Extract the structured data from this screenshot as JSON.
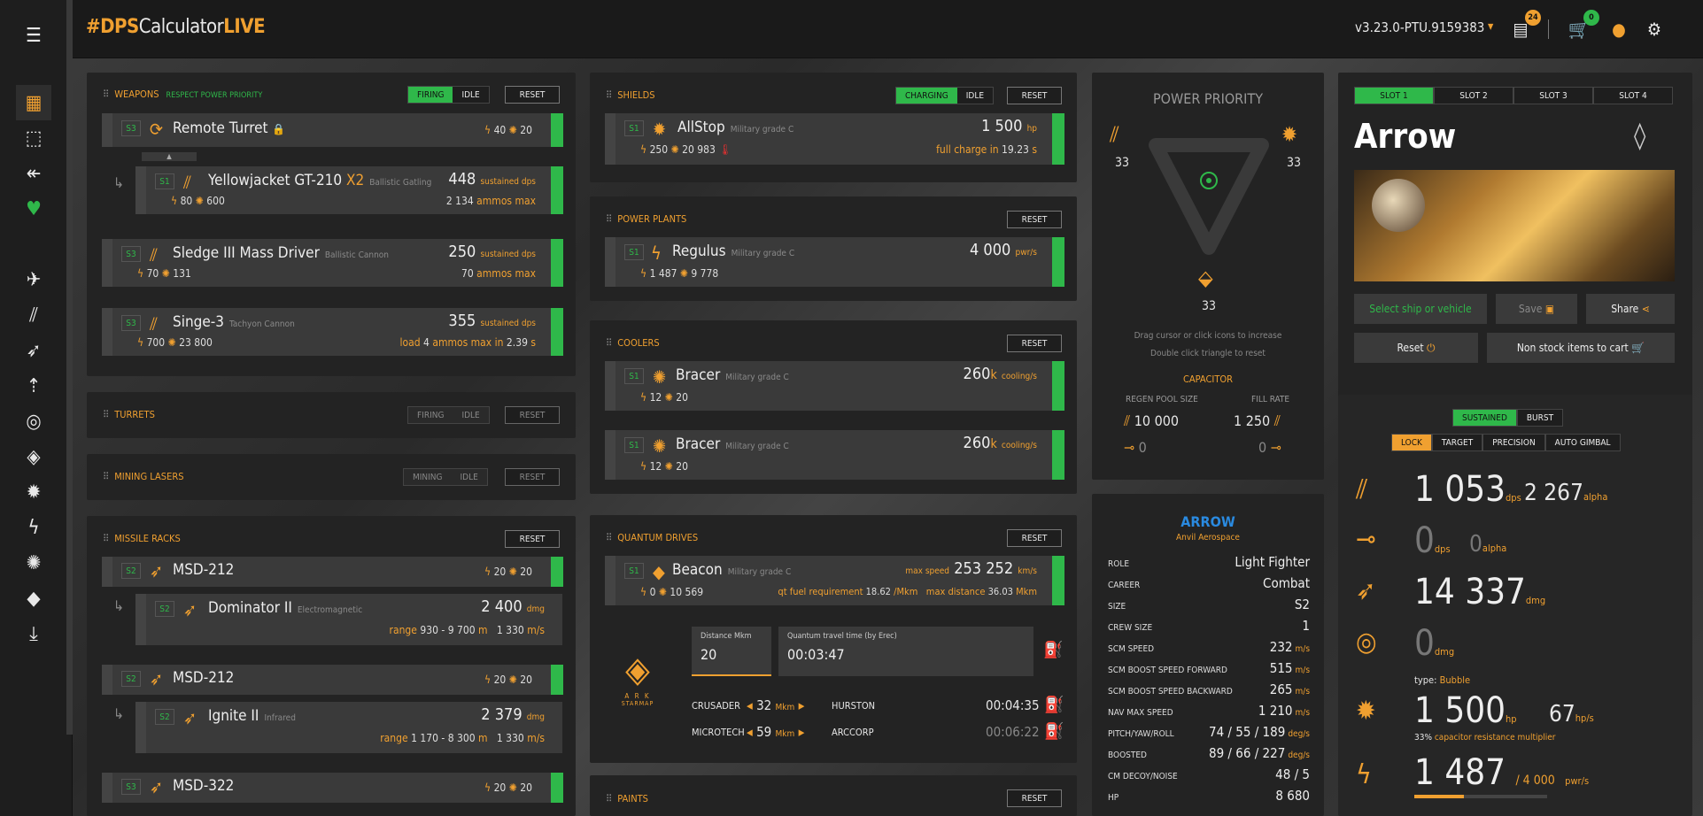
{
  "app": {
    "logo_hash": "#DPS",
    "logo_mid": "Calculator",
    "logo_end": "LIVE",
    "version": "v3.23.0-PTU.9159383",
    "cart_badge": "0",
    "docs_badge": "24"
  },
  "weapons": {
    "title": "WEAPONS",
    "subtitle": "RESPECT POWER PRIORITY",
    "firing": "FIRING",
    "idle": "IDLE",
    "reset": "RESET",
    "items": [
      {
        "slot": "S3",
        "name": "Remote Turret",
        "p1": "40",
        "p2": "20"
      },
      {
        "slot": "S1",
        "name": "Yellowjacket GT-210",
        "mult": "X2",
        "type": "Ballistic Gatling",
        "value": "448",
        "unit": "sustained dps",
        "p1": "80",
        "p2": "600",
        "extra": "2 134",
        "extra_label": "ammos max"
      },
      {
        "slot": "S3",
        "name": "Sledge III Mass Driver",
        "type": "Ballistic Cannon",
        "value": "250",
        "unit": "sustained dps",
        "p1": "70",
        "p2": "131",
        "extra": "70",
        "extra_label": "ammos max"
      },
      {
        "slot": "S3",
        "name": "Singe-3",
        "type": "Tachyon Cannon",
        "value": "355",
        "unit": "sustained dps",
        "p1": "700",
        "p2": "23 800",
        "load_label": "load",
        "load": "4",
        "ammo_label": "ammos max in",
        "time": "2.39",
        "time_unit": "s"
      }
    ]
  },
  "turrets": {
    "title": "TURRETS",
    "firing": "FIRING",
    "idle": "IDLE",
    "reset": "RESET"
  },
  "mining": {
    "title": "MINING LASERS",
    "mining": "MINING",
    "idle": "IDLE",
    "reset": "RESET"
  },
  "missiles": {
    "title": "MISSILE RACKS",
    "reset": "RESET",
    "items": [
      {
        "slot": "S2",
        "name": "MSD-212",
        "p1": "20",
        "p2": "20"
      },
      {
        "slot": "S2",
        "name": "Dominator II",
        "type": "Electromagnetic",
        "value": "2 400",
        "unit": "dmg",
        "range_label": "range",
        "range": "930 - 9 700",
        "range_unit": "m",
        "speed": "1 330",
        "speed_unit": "m/s"
      },
      {
        "slot": "S2",
        "name": "MSD-212",
        "p1": "20",
        "p2": "20"
      },
      {
        "slot": "S2",
        "name": "Ignite II",
        "type": "Infrared",
        "value": "2 379",
        "unit": "dmg",
        "range_label": "range",
        "range": "1 170 - 8 300",
        "range_unit": "m",
        "speed": "1 330",
        "speed_unit": "m/s"
      },
      {
        "slot": "S3",
        "name": "MSD-322",
        "p1": "20",
        "p2": "20"
      }
    ]
  },
  "shields": {
    "title": "SHIELDS",
    "charging": "CHARGING",
    "idle": "IDLE",
    "reset": "RESET",
    "slot": "S1",
    "name": "AllStop",
    "type": "Military grade C",
    "value": "1 500",
    "unit": "hp",
    "p1": "250",
    "p2": "20 983",
    "charge_label": "full charge in",
    "charge": "19.23",
    "charge_unit": "s"
  },
  "power_plants": {
    "title": "POWER PLANTS",
    "reset": "RESET",
    "slot": "S1",
    "name": "Regulus",
    "type": "Military grade C",
    "value": "4 000",
    "unit": "pwr/s",
    "p1": "1 487",
    "p2": "9 778"
  },
  "coolers": {
    "title": "COOLERS",
    "reset": "RESET",
    "items": [
      {
        "slot": "S1",
        "name": "Bracer",
        "type": "Military grade C",
        "value": "260",
        "mag": "k",
        "unit": "cooling/s",
        "p1": "12",
        "p2": "20"
      },
      {
        "slot": "S1",
        "name": "Bracer",
        "type": "Military grade C",
        "value": "260",
        "mag": "k",
        "unit": "cooling/s",
        "p1": "12",
        "p2": "20"
      }
    ]
  },
  "quantum": {
    "title": "QUANTUM DRIVES",
    "reset": "RESET",
    "slot": "S1",
    "name": "Beacon",
    "type": "Military grade C",
    "speed_label": "max speed",
    "speed": "253 252",
    "speed_unit": "km/s",
    "p1": "0",
    "p2": "10 569",
    "fuel_label": "qt fuel requirement",
    "fuel": "18.62",
    "fuel_unit": "/Mkm",
    "dist_label": "max distance",
    "dist": "36.03",
    "dist_unit": "Mkm",
    "distance_label": "Distance Mkm",
    "distance": "20",
    "travel_label": "Quantum travel time (by Erec)",
    "travel": "00:03:47",
    "ark_line1": "A R K",
    "ark_line2": "STARMAP",
    "routes": [
      {
        "from": "CRUSADER",
        "dist": "32",
        "unit": "Mkm",
        "to": "HURSTON",
        "time": "00:04:35"
      },
      {
        "from": "MICROTECH",
        "dist": "59",
        "unit": "Mkm",
        "to": "ARCCORP",
        "time": "00:06:22"
      }
    ]
  },
  "paints": {
    "title": "PAINTS",
    "reset": "RESET"
  },
  "power_priority": {
    "title": "POWER PRIORITY",
    "weapons": "33",
    "shields": "33",
    "thrusters": "33",
    "hint1": "Drag cursor or click icons to increase",
    "hint2": "Double click triangle to reset",
    "capacitor_title": "CAPACITOR",
    "regen_label": "REGEN POOL SIZE",
    "fill_label": "FILL RATE",
    "regen": "10 000",
    "fill": "1 250",
    "regen2": "0",
    "fill2": "0"
  },
  "ship_info": {
    "name": "ARROW",
    "maker": "Anvil Aerospace",
    "rows": [
      {
        "k": "ROLE",
        "v": "Light Fighter",
        "u": ""
      },
      {
        "k": "CAREER",
        "v": "Combat",
        "u": ""
      },
      {
        "k": "SIZE",
        "v": "S2",
        "u": ""
      },
      {
        "k": "CREW SIZE",
        "v": "1",
        "u": ""
      },
      {
        "k": "SCM SPEED",
        "v": "232",
        "u": "m/s"
      },
      {
        "k": "SCM BOOST SPEED FORWARD",
        "v": "515",
        "u": "m/s"
      },
      {
        "k": "SCM BOOST SPEED BACKWARD",
        "v": "265",
        "u": "m/s"
      },
      {
        "k": "NAV MAX SPEED",
        "v": "1 210",
        "u": "m/s"
      },
      {
        "k": "PITCH/YAW/ROLL",
        "v": "74 / 55 / 189",
        "u": "deg/s"
      },
      {
        "k": "BOOSTED",
        "v": "89 / 66 / 227",
        "u": "deg/s"
      },
      {
        "k": "CM DECOY/NOISE",
        "v": "48 / 5",
        "u": ""
      },
      {
        "k": "HP",
        "v": "8 680",
        "u": ""
      }
    ]
  },
  "slots": {
    "tabs": [
      "SLOT 1",
      "SLOT 2",
      "SLOT 3",
      "SLOT 4"
    ],
    "ship_name": "Arrow",
    "select": "Select ship or vehicle",
    "save": "Save",
    "share": "Share",
    "reset": "Reset",
    "cart": "Non stock items to cart"
  },
  "summary": {
    "mode": [
      "SUSTAINED",
      "BURST"
    ],
    "aim": [
      "LOCK",
      "TARGET",
      "PRECISION",
      "AUTO GIMBAL"
    ],
    "weapon_dps": "1 053",
    "weapon_dps_unit": "dps",
    "weapon_alpha": "2 267",
    "weapon_alpha_unit": "alpha",
    "turret_dps": "0",
    "turret_dps_unit": "dps",
    "turret_alpha": "0",
    "turret_alpha_unit": "alpha",
    "missile_dmg": "14 337",
    "missile_unit": "dmg",
    "emp_dmg": "0",
    "emp_unit": "dmg",
    "shield_type_label": "type:",
    "shield_type": "Bubble",
    "shield_hp": "1 500",
    "shield_hp_unit": "hp",
    "shield_regen": "67",
    "shield_regen_unit": "hp/s",
    "cap_pct": "33%",
    "cap_label": "capacitor resistance multiplier",
    "power": "1 487",
    "power_max": "/ 4 000",
    "power_unit": "pwr/s",
    "power_fill": 0.37
  }
}
